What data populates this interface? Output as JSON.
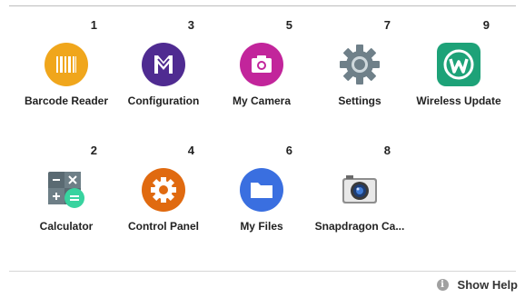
{
  "apps": [
    {
      "slot": "1",
      "label": "Barcode Reader",
      "icon": "barcode-icon",
      "color": "#f0a61c"
    },
    {
      "slot": "3",
      "label": "Configuration",
      "icon": "configuration-logo-icon",
      "color": "#4f2b91"
    },
    {
      "slot": "5",
      "label": "My Camera",
      "icon": "camera-icon",
      "color": "#c2259b"
    },
    {
      "slot": "7",
      "label": "Settings",
      "icon": "settings-gear-icon",
      "color": "#7d8e96"
    },
    {
      "slot": "9",
      "label": "Wireless Update",
      "icon": "wireless-update-icon",
      "color": "#1da278"
    },
    {
      "slot": "2",
      "label": "Calculator",
      "icon": "calculator-icon",
      "color": "#5a6a72"
    },
    {
      "slot": "4",
      "label": "Control Panel",
      "icon": "control-panel-gear-icon",
      "color": "#e06a10"
    },
    {
      "slot": "6",
      "label": "My Files",
      "icon": "folder-icon",
      "color": "#3a6fe0"
    },
    {
      "slot": "8",
      "label": "Snapdragon Ca...",
      "icon": "snapdragon-camera-icon",
      "color": "#9a9a9a"
    }
  ],
  "footer": {
    "info_icon": "info-icon",
    "help_label": "Show Help"
  }
}
